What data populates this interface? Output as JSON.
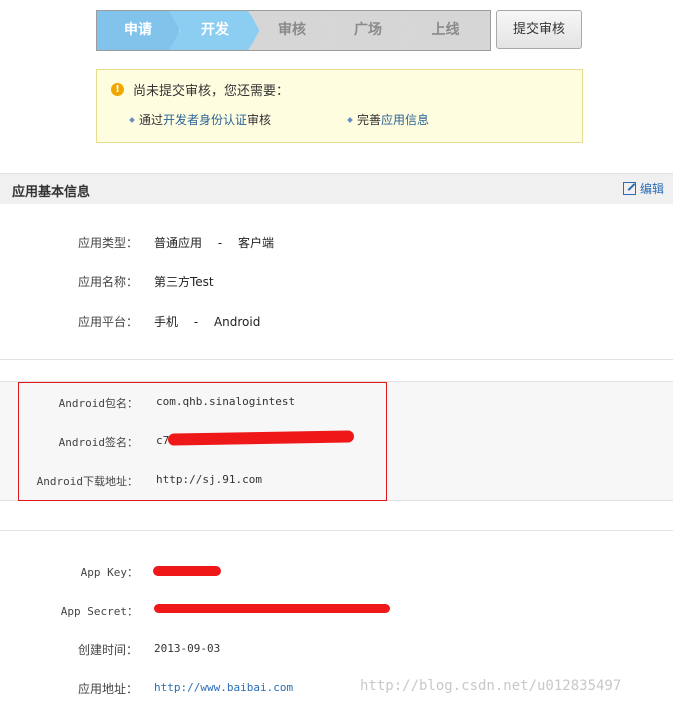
{
  "steps": [
    "申请",
    "开发",
    "审核",
    "广场",
    "上线"
  ],
  "submit_button": "提交审核",
  "notice": {
    "title": "尚未提交审核，您还需要：",
    "item1_prefix": "通过",
    "item1_link": "开发者身份认证",
    "item1_suffix": "审核",
    "item2_prefix": "完善",
    "item2_link": "应用信息"
  },
  "section": {
    "title": "应用基本信息",
    "edit_label": "编辑"
  },
  "basic": {
    "type_label": "应用类型：",
    "type_value": "普通应用　 -　 客户端",
    "name_label": "应用名称：",
    "name_value": "第三方Test",
    "platform_label": "应用平台：",
    "platform_value": "手机　 -　 Android"
  },
  "android": {
    "package_label": "Android包名：",
    "package_value": "com.qhb.sinalogintest",
    "signature_label": "Android签名：",
    "signature_value": "c7",
    "download_label": "Android下载地址：",
    "download_value": "http://sj.91.com"
  },
  "keys": {
    "appkey_label": "App Key：",
    "appsecret_label": "App Secret：",
    "created_label": "创建时间：",
    "created_value": "2013-09-03",
    "url_label": "应用地址：",
    "url_value": "http://www.baibai.com"
  },
  "watermark": "http://blog.csdn.net/u012835497",
  "colors": {
    "active_step": "#82c3ec",
    "inactive_step": "#d6d6d6",
    "notice_bg": "#fffde0",
    "highlight_border": "#e0181c",
    "redaction": "#ee1818",
    "link": "#2a6db5"
  }
}
